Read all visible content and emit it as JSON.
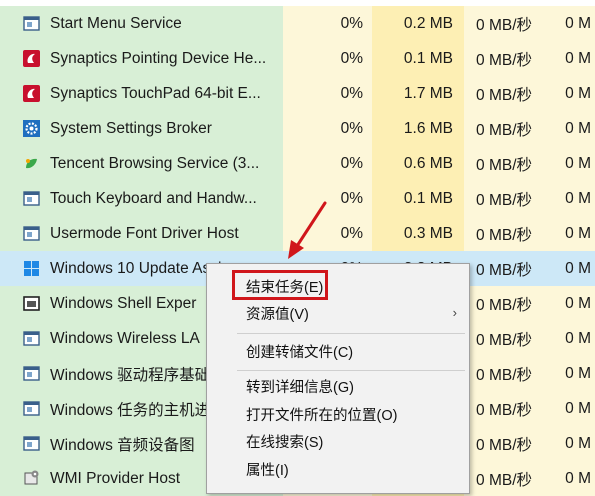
{
  "processes": [
    {
      "name": "Start Menu Service",
      "icon": "window-frame-icon",
      "cpu": "0%",
      "memory": "0.2 MB",
      "disk": "0 MB/秒",
      "network": "0 M"
    },
    {
      "name": "Synaptics Pointing Device He...",
      "icon": "synaptics-icon",
      "cpu": "0%",
      "memory": "0.1 MB",
      "disk": "0 MB/秒",
      "network": "0 M"
    },
    {
      "name": "Synaptics TouchPad 64-bit E...",
      "icon": "synaptics-icon",
      "cpu": "0%",
      "memory": "1.7 MB",
      "disk": "0 MB/秒",
      "network": "0 M"
    },
    {
      "name": "System Settings Broker",
      "icon": "gear-icon",
      "cpu": "0%",
      "memory": "1.6 MB",
      "disk": "0 MB/秒",
      "network": "0 M"
    },
    {
      "name": "Tencent Browsing Service (3...",
      "icon": "tencent-leaf-icon",
      "cpu": "0%",
      "memory": "0.6 MB",
      "disk": "0 MB/秒",
      "network": "0 M"
    },
    {
      "name": "Touch Keyboard and Handw...",
      "icon": "window-frame-icon",
      "cpu": "0%",
      "memory": "0.1 MB",
      "disk": "0 MB/秒",
      "network": "0 M"
    },
    {
      "name": "Usermode Font Driver Host",
      "icon": "window-frame-icon",
      "cpu": "0%",
      "memory": "0.3 MB",
      "disk": "0 MB/秒",
      "network": "0 M"
    },
    {
      "name": "Windows 10 Update Assis",
      "icon": "windows-logo-icon",
      "cpu": "0%",
      "memory": "3.8 MB",
      "disk": "0 MB/秒",
      "network": "0 M"
    },
    {
      "name": "Windows Shell Exper",
      "icon": "window-frame-dark-icon",
      "cpu": "",
      "memory": "",
      "disk": "0 MB/秒",
      "network": "0 M"
    },
    {
      "name": "Windows Wireless LA",
      "icon": "window-frame-icon",
      "cpu": "",
      "memory": "",
      "disk": "0 MB/秒",
      "network": "0 M"
    },
    {
      "name": "Windows 驱动程序基础",
      "icon": "window-frame-icon",
      "cpu": "",
      "memory": "",
      "disk": "0 MB/秒",
      "network": "0 M"
    },
    {
      "name": "Windows 任务的主机进",
      "icon": "window-frame-icon",
      "cpu": "",
      "memory": "",
      "disk": "0 MB/秒",
      "network": "0 M"
    },
    {
      "name": "Windows 音频设备图",
      "icon": "window-frame-icon",
      "cpu": "",
      "memory": "",
      "disk": "0 MB/秒",
      "network": "0 M"
    },
    {
      "name": "WMI Provider Host",
      "icon": "wmi-provider-icon",
      "cpu": "",
      "memory": "",
      "disk": "0 MB/秒",
      "network": "0 M"
    }
  ],
  "context_menu": {
    "end_task": "结束任务(E)",
    "resource_values": "资源值(V)",
    "create_dump": "创建转储文件(C)",
    "go_to_details": "转到详细信息(G)",
    "open_file_location": "打开文件所在的位置(O)",
    "search_online": "在线搜索(S)",
    "properties": "属性(I)",
    "submenu_arrow": "›"
  },
  "colors": {
    "name_column": "#d8efd6",
    "cpu_column": "#fdf7d9",
    "memory_column": "#fdefb4",
    "selected_row": "#cde8f7",
    "annotation_red": "#d0161b"
  }
}
